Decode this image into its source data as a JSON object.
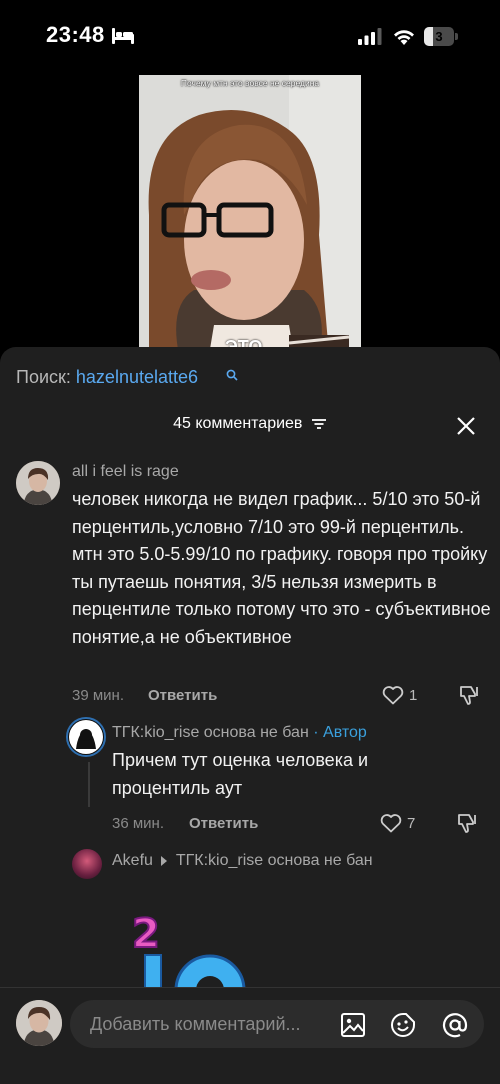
{
  "status_bar": {
    "time": "23:48",
    "battery_level": "3"
  },
  "video": {
    "caption": "Почему мтн это вовсе не середина",
    "subtitle": "ЭТО"
  },
  "search": {
    "label": "Поиск:",
    "query": "hazelnutelatte6"
  },
  "comments_header": {
    "title": "45 комментариев"
  },
  "comments": [
    {
      "author": "all i feel is rage",
      "text": "человек никогда не видел график... 5/10 это 50-й перцентиль,условно 7/10 это 99-й перцентиль. мтн это 5.0-5.99/10 по графику. говоря про тройку ты путаешь понятия, 3/5 нельзя измерить в перцентиле только потому что это - субъективное понятие,а не объективное",
      "time": "39 мин.",
      "reply_label": "Ответить",
      "likes": "1"
    }
  ],
  "replies": [
    {
      "author": "ТГК:kio_rise основа не бан",
      "badge": "· Автор",
      "text": "Причем тут оценка человека и процентиль аут",
      "time": "36 мин.",
      "reply_label": "Ответить",
      "likes": "7"
    },
    {
      "author": "Akefu",
      "reply_to": "ТГК:kio_rise основа не бан"
    }
  ],
  "input": {
    "placeholder": "Добавить комментарий..."
  },
  "colors": {
    "accent_link": "#5aa9f0",
    "author_badge": "#3aa0dd",
    "sheet_bg": "#1f1f1f"
  }
}
